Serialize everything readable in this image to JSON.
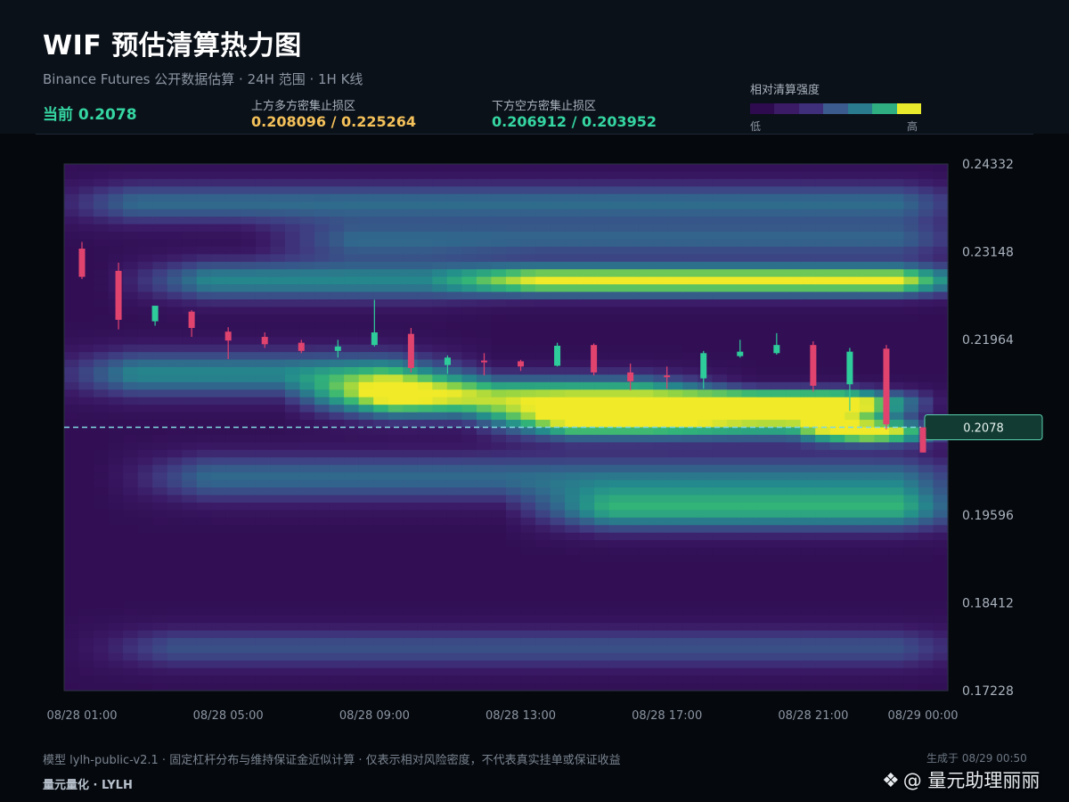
{
  "header": {
    "title": "WIF 预估清算热力图",
    "subtitle": "Binance Futures 公开数据估算 · 24H 范围 · 1H K线",
    "current": "当前 0.2078",
    "upper_label": "上方多方密集止损区",
    "upper_value": "0.208096 / 0.225264",
    "lower_label": "下方空方密集止损区",
    "lower_value": "0.206912 / 0.203952"
  },
  "legend": {
    "title": "相对清算强度",
    "low": "低",
    "high": "高",
    "colors": [
      "#2e0b4e",
      "#3b1a66",
      "#3f2e7a",
      "#3b5a8e",
      "#2b7b8e",
      "#2fae82",
      "#e9ea2b"
    ]
  },
  "footer": {
    "note": "模型 lylh-public-v2.1 · 固定杠杆分布与维持保证金近似计算 · 仅表示相对风险密度，不代表真实挂单或保证收益",
    "brand": "量元量化 · LYLH",
    "generated": "生成于 08/29 00:50"
  },
  "watermark": {
    "icon": "diamond-logo-icon",
    "text": "@ 量元助理丽丽"
  },
  "colors": {
    "accent_up": "#2ecc9a",
    "accent_down": "#e0436e",
    "upper_value_color": "#f4c15a",
    "lower_value_color": "#35d6a2",
    "current_line": "#7fd8e0"
  },
  "chart_data": {
    "type": "heatmap",
    "title": "WIF 预估清算热力图",
    "xlabel": "",
    "ylabel": "",
    "x_ticks": [
      "08/28 01:00",
      "08/28 05:00",
      "08/28 09:00",
      "08/28 13:00",
      "08/28 17:00",
      "08/28 21:00",
      "08/29 00:00"
    ],
    "y_ticks": [
      "0.24332",
      "0.23148",
      "0.21964",
      "0.20780",
      "0.19596",
      "0.18412",
      "0.17228"
    ],
    "ylim": [
      0.17228,
      0.24332
    ],
    "current_price": 0.2078,
    "current_price_label": "0.2078",
    "hours": [
      "08/28 01:00",
      "08/28 02:00",
      "08/28 03:00",
      "08/28 04:00",
      "08/28 05:00",
      "08/28 06:00",
      "08/28 07:00",
      "08/28 08:00",
      "08/28 09:00",
      "08/28 10:00",
      "08/28 11:00",
      "08/28 12:00",
      "08/28 13:00",
      "08/28 14:00",
      "08/28 15:00",
      "08/28 16:00",
      "08/28 17:00",
      "08/28 18:00",
      "08/28 19:00",
      "08/28 20:00",
      "08/28 21:00",
      "08/28 22:00",
      "08/28 23:00",
      "08/29 00:00"
    ],
    "candles": [
      {
        "o": 0.2319,
        "h": 0.2328,
        "l": 0.2278,
        "c": 0.2281
      },
      {
        "o": 0.2289,
        "h": 0.23,
        "l": 0.221,
        "c": 0.2223
      },
      {
        "o": 0.2221,
        "h": 0.2235,
        "l": 0.2215,
        "c": 0.2242
      },
      {
        "o": 0.2234,
        "h": 0.2236,
        "l": 0.22,
        "c": 0.2212
      },
      {
        "o": 0.2207,
        "h": 0.2213,
        "l": 0.217,
        "c": 0.2195
      },
      {
        "o": 0.22,
        "h": 0.2206,
        "l": 0.2185,
        "c": 0.219
      },
      {
        "o": 0.2192,
        "h": 0.2196,
        "l": 0.2178,
        "c": 0.2181
      },
      {
        "o": 0.2181,
        "h": 0.2196,
        "l": 0.2172,
        "c": 0.2187
      },
      {
        "o": 0.2189,
        "h": 0.225,
        "l": 0.2187,
        "c": 0.2206
      },
      {
        "o": 0.2204,
        "h": 0.2212,
        "l": 0.2152,
        "c": 0.2158
      },
      {
        "o": 0.2162,
        "h": 0.2175,
        "l": 0.215,
        "c": 0.2172
      },
      {
        "o": 0.2168,
        "h": 0.2178,
        "l": 0.2148,
        "c": 0.2166
      },
      {
        "o": 0.2167,
        "h": 0.2169,
        "l": 0.2154,
        "c": 0.216
      },
      {
        "o": 0.2161,
        "h": 0.2192,
        "l": 0.216,
        "c": 0.2188
      },
      {
        "o": 0.2189,
        "h": 0.2191,
        "l": 0.2148,
        "c": 0.2152
      },
      {
        "o": 0.2152,
        "h": 0.2164,
        "l": 0.2128,
        "c": 0.214
      },
      {
        "o": 0.2148,
        "h": 0.216,
        "l": 0.213,
        "c": 0.2146
      },
      {
        "o": 0.2144,
        "h": 0.2181,
        "l": 0.213,
        "c": 0.2178
      },
      {
        "o": 0.2174,
        "h": 0.2196,
        "l": 0.2172,
        "c": 0.218
      },
      {
        "o": 0.2178,
        "h": 0.2205,
        "l": 0.2176,
        "c": 0.2189
      },
      {
        "o": 0.2189,
        "h": 0.2194,
        "l": 0.2126,
        "c": 0.2134
      },
      {
        "o": 0.2136,
        "h": 0.2185,
        "l": 0.21,
        "c": 0.218
      },
      {
        "o": 0.2184,
        "h": 0.2189,
        "l": 0.2075,
        "c": 0.2082
      },
      {
        "o": 0.2078,
        "h": 0.2078,
        "l": 0.2044,
        "c": 0.2044
      }
    ],
    "bands": [
      {
        "price": 0.2276,
        "strength": 0.95,
        "start_hour": 11,
        "end_hour": 24,
        "width": 0.0022
      },
      {
        "price": 0.2276,
        "strength": 0.55,
        "start_hour": 2,
        "end_hour": 11,
        "width": 0.003
      },
      {
        "price": 0.2112,
        "strength": 1.0,
        "start_hour": 17,
        "end_hour": 22.5,
        "width": 0.0018
      },
      {
        "price": 0.2118,
        "strength": 0.85,
        "start_hour": 7,
        "end_hour": 17,
        "width": 0.003
      },
      {
        "price": 0.2085,
        "strength": 0.8,
        "start_hour": 12,
        "end_hour": 22,
        "width": 0.0024
      },
      {
        "price": 0.207,
        "strength": 1.0,
        "start_hour": 21,
        "end_hour": 23,
        "width": 0.0015
      },
      {
        "price": 0.215,
        "strength": 0.55,
        "start_hour": 0,
        "end_hour": 10,
        "width": 0.0034
      },
      {
        "price": 0.238,
        "strength": 0.45,
        "start_hour": 0,
        "end_hour": 24,
        "width": 0.003
      },
      {
        "price": 0.233,
        "strength": 0.4,
        "start_hour": 6,
        "end_hour": 24,
        "width": 0.0025
      },
      {
        "price": 0.1965,
        "strength": 0.6,
        "start_hour": 13,
        "end_hour": 24,
        "width": 0.003
      },
      {
        "price": 0.201,
        "strength": 0.45,
        "start_hour": 2,
        "end_hour": 24,
        "width": 0.0035
      },
      {
        "price": 0.178,
        "strength": 0.35,
        "start_hour": 1,
        "end_hour": 24,
        "width": 0.003
      }
    ]
  }
}
